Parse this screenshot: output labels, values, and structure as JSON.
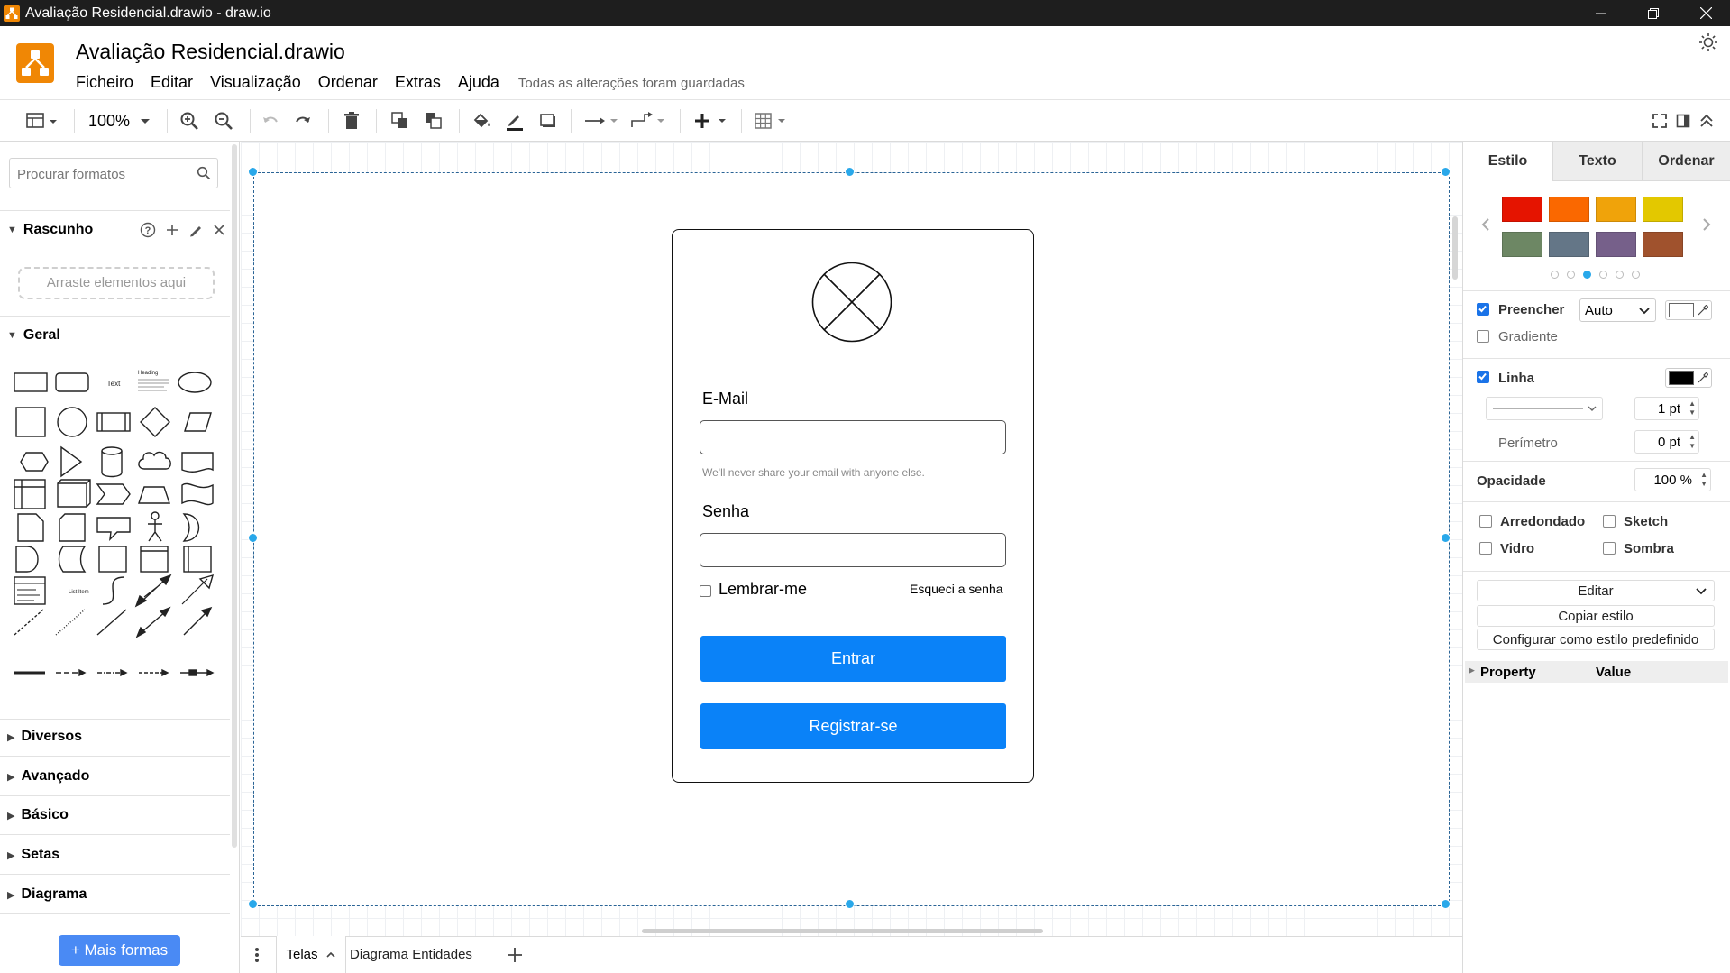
{
  "window": {
    "title": "Avaliação Residencial.drawio - draw.io"
  },
  "header": {
    "doc_title": "Avaliação Residencial.drawio",
    "menu": [
      "Ficheiro",
      "Editar",
      "Visualização",
      "Ordenar",
      "Extras",
      "Ajuda"
    ],
    "saved_status": "Todas as alterações foram guardadas"
  },
  "toolbar": {
    "zoom": "100%"
  },
  "sidebar": {
    "search_placeholder": "Procurar formatos",
    "scratchpad_title": "Rascunho",
    "drop_hint": "Arraste elementos aqui",
    "general_title": "Geral",
    "text_shape_label": "Text",
    "heading_shape_label": "Heading",
    "list_shape_label": "List Item",
    "sections": [
      "Diversos",
      "Avançado",
      "Básico",
      "Setas",
      "Diagrama"
    ],
    "more_shapes": "+ Mais formas"
  },
  "mockup": {
    "email_label": "E-Mail",
    "email_help": "We'll never share your email with anyone else.",
    "password_label": "Senha",
    "remember_label": "Lembrar-me",
    "forgot_link": "Esqueci a senha",
    "login_button": "Entrar",
    "register_button": "Registrar-se"
  },
  "page_tabs": {
    "active": "Telas",
    "other": "Diagrama Entidades"
  },
  "format_panel": {
    "tabs": [
      "Estilo",
      "Texto",
      "Ordenar"
    ],
    "palette": [
      "#e51400",
      "#fa6800",
      "#f0a30a",
      "#e3c800",
      "#6d8764",
      "#647687",
      "#76608a",
      "#a0522d"
    ],
    "fill_label": "Preencher",
    "fill_mode": "Auto",
    "fill_color": "#ffffff",
    "gradient_label": "Gradiente",
    "line_label": "Linha",
    "line_color": "#000000",
    "line_width": "1 pt",
    "perimeter_label": "Perímetro",
    "perimeter_value": "0 pt",
    "opacity_label": "Opacidade",
    "opacity_value": "100 %",
    "rounded_label": "Arredondado",
    "sketch_label": "Sketch",
    "glass_label": "Vidro",
    "shadow_label": "Sombra",
    "edit_button": "Editar",
    "copy_style_button": "Copiar estilo",
    "set_default_button": "Configurar como estilo predefinido",
    "prop_col_property": "Property",
    "prop_col_value": "Value"
  }
}
